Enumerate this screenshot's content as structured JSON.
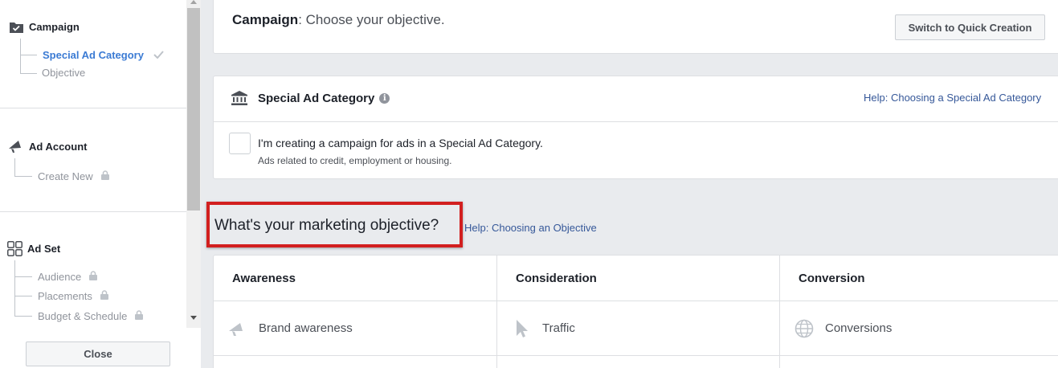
{
  "sidebar": {
    "campaign": {
      "title": "Campaign",
      "items": [
        {
          "label": "Special Ad Category"
        },
        {
          "label": "Objective"
        }
      ]
    },
    "ad_account": {
      "title": "Ad Account",
      "items": [
        {
          "label": "Create New"
        }
      ]
    },
    "ad_set": {
      "title": "Ad Set",
      "items": [
        {
          "label": "Audience"
        },
        {
          "label": "Placements"
        },
        {
          "label": "Budget & Schedule"
        }
      ]
    },
    "close_label": "Close"
  },
  "header": {
    "title_bold": "Campaign",
    "title_rest": ": Choose your objective.",
    "quick_creation_label": "Switch to Quick Creation"
  },
  "special_ad": {
    "title": "Special Ad Category",
    "help_link": "Help: Choosing a Special Ad Category",
    "checkbox_label": "I'm creating a campaign for ads in a Special Ad Category.",
    "checkbox_sub": "Ads related to credit, employment or housing."
  },
  "objective": {
    "heading": "What's your marketing objective?",
    "help_link": "Help: Choosing an Objective",
    "columns": [
      {
        "title": "Awareness",
        "first_item": "Brand awareness",
        "icon": "megaphone-icon"
      },
      {
        "title": "Consideration",
        "first_item": "Traffic",
        "icon": "cursor-icon"
      },
      {
        "title": "Conversion",
        "first_item": "Conversions",
        "icon": "globe-icon"
      }
    ]
  },
  "colors": {
    "accent_link": "#365899",
    "active_item": "#3b7bd4",
    "highlight_border": "#d21f1f"
  }
}
